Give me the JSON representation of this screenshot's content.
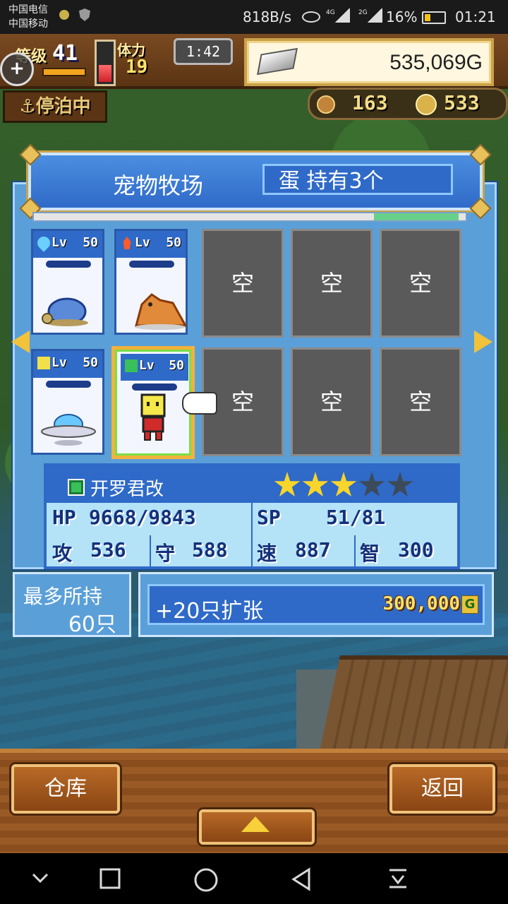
{
  "status_bar": {
    "carrier1": "中国电信",
    "carrier2": "中国移动",
    "speed": "818B/s",
    "sig1": "4G",
    "sig2": "2G",
    "battery_pct": "16%",
    "time": "01:21"
  },
  "hud": {
    "level_label": "等级",
    "level": "41",
    "stamina_label": "体力",
    "stamina": "19",
    "stamina_level": 0.45,
    "timer": "1:42",
    "gold": "535,069G",
    "anchor_status": "停泊中",
    "resource1": "163",
    "resource2": "533"
  },
  "dialog": {
    "title": "宠物牧场",
    "egg_status": "蛋 持有3个",
    "empty_label": "空",
    "pets": [
      {
        "element": "water",
        "lv_label": "Lv",
        "lv": "50",
        "sprite": "turtle"
      },
      {
        "element": "fire",
        "lv_label": "Lv",
        "lv": "50",
        "sprite": "beast"
      },
      {
        "element": "light",
        "lv_label": "Lv",
        "lv": "50",
        "sprite": "ufo"
      },
      {
        "element": "leaf",
        "lv_label": "Lv",
        "lv": "50",
        "sprite": "robot"
      }
    ]
  },
  "selected_pet": {
    "name": "开罗君改",
    "stars_on": 3,
    "stars_total": 5,
    "hp_label": "HP",
    "hp": "9668/9843",
    "sp_label": "SP",
    "sp": "51/81",
    "atk_label": "攻",
    "atk": "536",
    "def_label": "守",
    "def": "588",
    "spd_label": "速",
    "spd": "887",
    "int_label": "智",
    "int": "300"
  },
  "capacity": {
    "label": "最多所持",
    "value": "60只"
  },
  "expand": {
    "label": "+20只扩张",
    "cost": "300,000",
    "currency": "G"
  },
  "bottom": {
    "warehouse": "仓库",
    "back": "返回"
  },
  "colors": {
    "panel_blue": "#2f6ac8",
    "accent_gold": "#f3b23a"
  }
}
